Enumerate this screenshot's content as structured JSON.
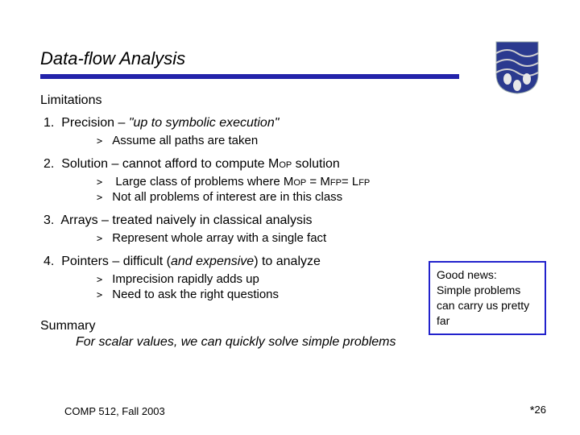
{
  "title": "Data-flow Analysis",
  "section": "Limitations",
  "items": {
    "p1": {
      "lead": "1.",
      "head": "Precision – ",
      "ital": "\"up to symbolic execution\"",
      "sub1": "Assume all paths are taken"
    },
    "p2": {
      "lead": "2.",
      "head": "Solution – cannot afford to compute M",
      "sc1": "OP",
      "tail": " solution",
      "sub1a": "Large class of problems where M",
      "sub1s1": "OP",
      "sub1b": " = M",
      "sub1s2": "FP",
      "sub1c": "= L",
      "sub1s3": "FP",
      "sub2": "Not all problems of interest are in this class"
    },
    "p3": {
      "lead": "3.",
      "head": "Arrays – treated naively in classical analysis",
      "sub1": "Represent whole array with a single fact"
    },
    "p4": {
      "lead": "4.",
      "head": "Pointers – difficult (",
      "ital": "and expensive",
      "tail": ") to analyze",
      "sub1": "Imprecision rapidly adds up",
      "sub2": "Need to ask the right questions"
    }
  },
  "callout": {
    "l1": "Good news:",
    "l2": "Simple problems can carry us pretty far"
  },
  "summary": {
    "head": "Summary",
    "body": "For scalar values, we can quickly solve simple problems"
  },
  "footer": {
    "course": "COMP 512, Fall 2003",
    "star": "*",
    "page": "26"
  }
}
